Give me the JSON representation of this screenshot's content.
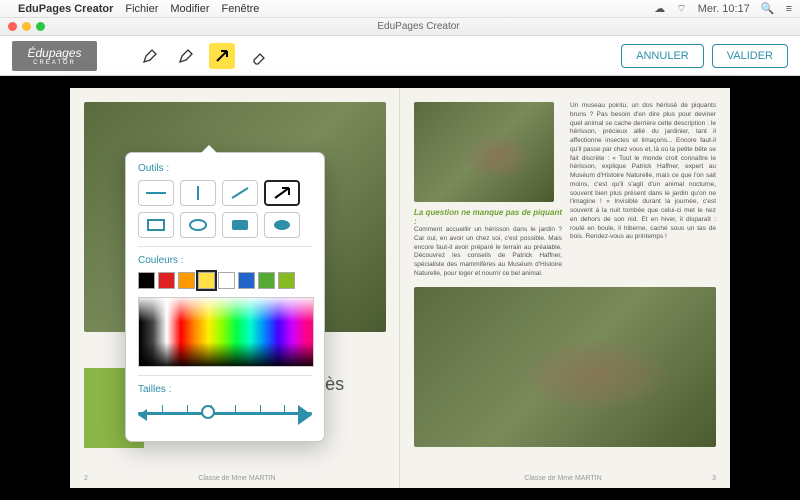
{
  "menubar": {
    "app": "EduPages Creator",
    "items": [
      "Fichier",
      "Modifier",
      "Fenêtre"
    ],
    "clock": "Mer. 10:17"
  },
  "window": {
    "title": "EduPages Creator"
  },
  "logo": {
    "line1": "Édupages",
    "line2": "CREATOR"
  },
  "toolbar": {
    "cancel": "ANNULER",
    "confirm": "VALIDER"
  },
  "popover": {
    "tools_label": "Outils :",
    "colors_label": "Couleurs :",
    "sizes_label": "Tailles :",
    "swatches": [
      "#000000",
      "#d22",
      "#f90",
      "#ffe146",
      "#ffffff",
      "#2266cc",
      "#55aa33",
      "#88bb22"
    ],
    "selected_swatch": 3,
    "shapes_row1": [
      "hline",
      "vline",
      "diag",
      "arrow"
    ],
    "shapes_row2": [
      "rect",
      "ellipse",
      "frect",
      "fellipse"
    ],
    "selected_shape": "arrow",
    "size_value": 3,
    "size_min": 1,
    "size_max": 7
  },
  "book": {
    "left": {
      "headline": "e hérisson peut être très mignon !",
      "footer": "Classe de Mme MARTIN",
      "page_num": "2"
    },
    "right": {
      "subhead": "La question ne manque pas de piquant :",
      "body1": "Comment accueillir un hérisson dans le jardin ? Car oui, en avoir un chez soi, c'est possible. Mais encore faut-il avoir préparé le terrain au préalable. Découvrez les conseils de Patrick Haffner, spécialiste des mammifères au Muséum d'Histoire Naturelle, pour loger et nourrir ce bel animal.",
      "body2": "Un museau pointu, un dos hérissé de piquants bruns ? Pas besoin d'en dire plus pour deviner quel animal se cache derrière cette description : le hérisson, précieux allié du jardinier, tant il affectionne insectes et limaçons... Encore faut-il qu'il passe par chez vous et, là où la petite bête se fait discrète : « Tout le monde croit connaître le hérisson, explique Patrick Haffner, expert au Muséum d'Histoire Naturelle, mais ce que l'on sait moins, c'est qu'il s'agit d'un animal nocturne, souvent bien plus présent dans le jardin qu'on ne l'imagine ! » Invisible durant la journée, c'est souvent à la nuit tombée que celui-ci met le nez en dehors de son nid. Et en hiver, il disparaît : roulé en boule, il hiberne, caché sous un tas de bois. Rendez-vous au printemps !",
      "footer": "Classe de Mme MARTIN",
      "page_num": "3"
    }
  }
}
